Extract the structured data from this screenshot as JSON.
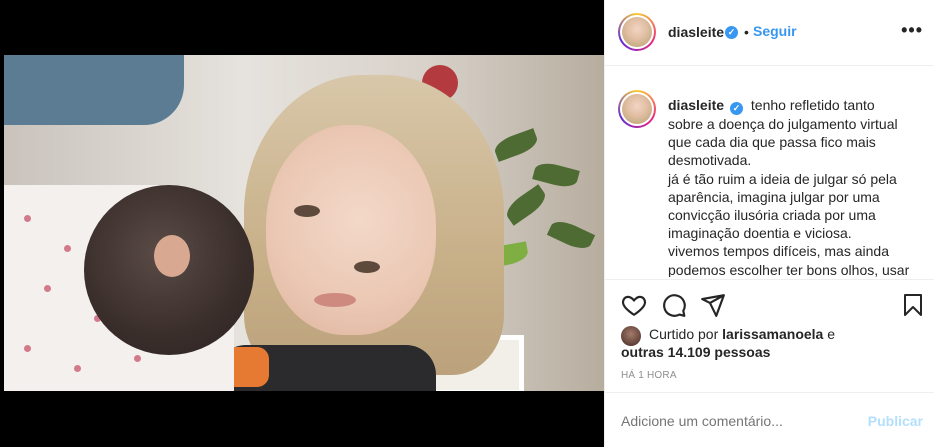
{
  "post": {
    "username": "diasleite",
    "verified_mark": "✓",
    "separator": "•",
    "follow_label": "Seguir",
    "more_label": "•••",
    "caption_lines": [
      "tenho refletido tanto",
      "sobre a doença do julgamento virtual",
      "que cada dia que passa fico mais",
      "desmotivada.",
      "já é tão ruim a ideia de julgar só pela",
      "aparência, imagina julgar por uma",
      "convicção ilusória criada por uma",
      "imaginação doentia e viciosa.",
      "vivemos tempos difíceis, mas ainda",
      "podemos escolher ter bons olhos, usar"
    ],
    "liked_prefix": "Curtido por",
    "liked_user": "larissamanoela",
    "liked_conj": "e",
    "liked_others": "outras 14.109 pessoas",
    "timestamp": "HÁ 1 HORA",
    "comment_placeholder": "Adicione um comentário...",
    "publish_label": "Publicar"
  },
  "icons": {
    "like": "heart-icon",
    "comment": "comment-icon",
    "share": "share-icon",
    "save": "bookmark-icon",
    "more": "more-icon",
    "verified": "verified-icon"
  },
  "colors": {
    "accent": "#3897f0",
    "publish_disabled": "#b2dffc",
    "muted": "#8e8e8e",
    "text": "#262626"
  }
}
